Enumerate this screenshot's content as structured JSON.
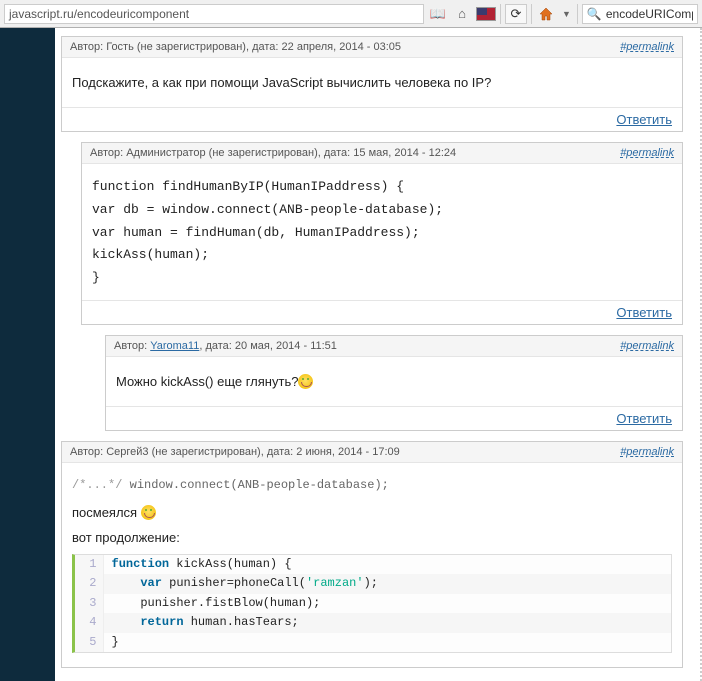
{
  "browser": {
    "url": "javascript.ru/encodeuricomponent",
    "search_value": "encodeURICompone"
  },
  "labels": {
    "author": "Автор:",
    "date": ", дата:",
    "not_registered": "(не зарегистрирован)",
    "permalink": "#permalink",
    "reply": "Ответить"
  },
  "comments": [
    {
      "author": "Гость",
      "is_registered": false,
      "date": "22 апреля, 2014 - 03:05",
      "body_text": "Подскажите, а как при помощи JavaScript вычислить человека по IP?"
    },
    {
      "author": "Администратор",
      "is_registered": false,
      "date": "15 мая, 2014 - 12:24",
      "code_lines": [
        "function findHumanByIP(HumanIPaddress) {",
        "var db = window.connect(ANB-people-database);",
        "var human = findHuman(db, HumanIPaddress);",
        "kickAss(human);",
        "}"
      ]
    },
    {
      "author": "Yaroma11",
      "is_registered": true,
      "date": "20 мая, 2014 - 11:51",
      "body_text": "Можно kickAss() еще глянуть?"
    },
    {
      "author": "Сергей3",
      "is_registered": false,
      "date": "2 июня, 2014 - 17:09",
      "plain_code": "/*...*/ window.connect(ANB-people-database);",
      "body_text_1": "посмеялся ",
      "body_text_2": "вот продолжение:",
      "code2": [
        {
          "n": "1",
          "kw": "function",
          "rest": " kickAss(human) {"
        },
        {
          "n": "2",
          "indent": "    ",
          "kw": "var",
          "rest": " punisher=phoneCall(",
          "str": "'ramzan'",
          "tail": ");"
        },
        {
          "n": "3",
          "indent": "    ",
          "rest": "punisher.fistBlow(human);"
        },
        {
          "n": "4",
          "indent": "    ",
          "kw": "return",
          "rest": " human.hasTears;"
        },
        {
          "n": "5",
          "rest": "}"
        }
      ]
    }
  ]
}
